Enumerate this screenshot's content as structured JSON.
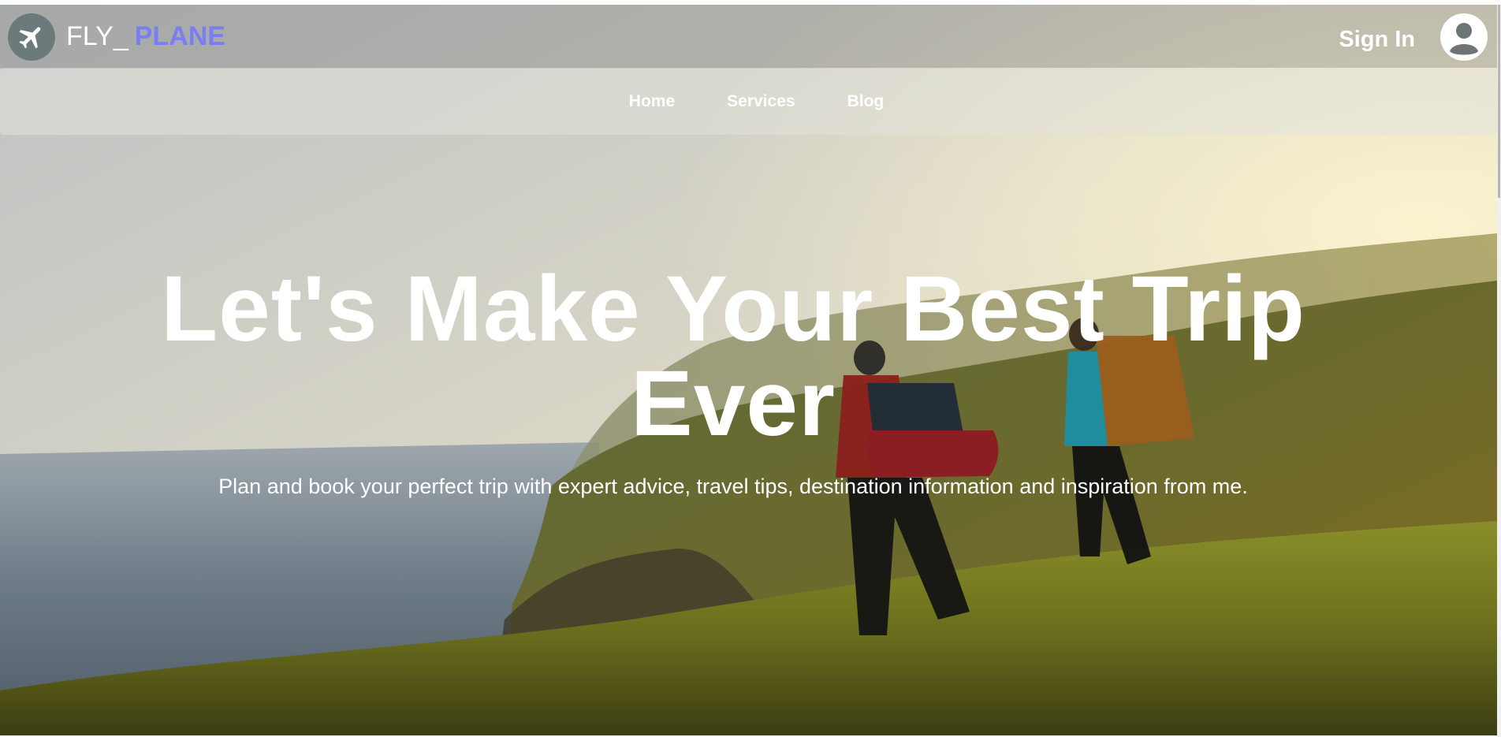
{
  "header": {
    "logo_icon": "airplane-icon",
    "brand_prefix": "FLY_",
    "brand_accent": "PLANE",
    "brand_accent_color": "#7b7ef2",
    "signin_label": "Sign In",
    "avatar_icon": "user-avatar-icon"
  },
  "nav": {
    "items": [
      {
        "label": "Home"
      },
      {
        "label": "Services"
      },
      {
        "label": "Blog"
      }
    ]
  },
  "hero": {
    "headline": "Let's Make Your Best Trip Ever",
    "subtitle": "Plan and book your perfect trip with expert advice, travel tips, destination information and inspiration from me.",
    "background_image": "hikers-on-coastal-hillside"
  }
}
